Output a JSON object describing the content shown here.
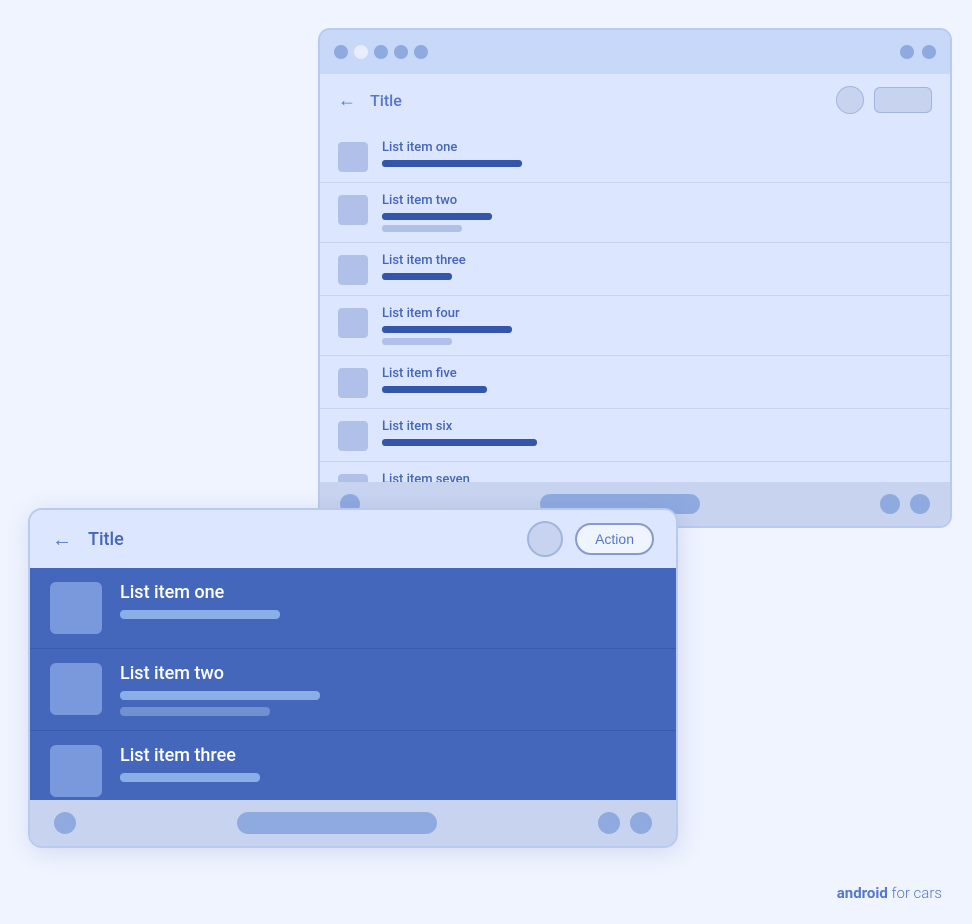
{
  "back_window": {
    "title": "Title",
    "action_btn": "",
    "list_items": [
      {
        "label": "List item one",
        "bar1_w": 140,
        "bar2_w": 0,
        "bar3_w": 0
      },
      {
        "label": "List item two",
        "bar1_w": 110,
        "bar2_w": 80,
        "bar3_w": 0
      },
      {
        "label": "List item three",
        "bar1_w": 70,
        "bar2_w": 0,
        "bar3_w": 0
      },
      {
        "label": "List item four",
        "bar1_w": 130,
        "bar2_w": 70,
        "bar3_w": 0
      },
      {
        "label": "List item five",
        "bar1_w": 105,
        "bar2_w": 0,
        "bar3_w": 0
      },
      {
        "label": "List item six",
        "bar1_w": 155,
        "bar2_w": 0,
        "bar3_w": 0
      },
      {
        "label": "List item seven",
        "bar1_w": 100,
        "bar2_w": 0,
        "bar3_w": 0
      }
    ]
  },
  "front_window": {
    "title": "Title",
    "action_label": "Action",
    "list_items": [
      {
        "label": "List item one",
        "bar1_w": 160,
        "bar2_w": 0,
        "bar3_w": 0
      },
      {
        "label": "List item two",
        "bar1_w": 200,
        "bar2_w": 150,
        "bar3_w": 0
      },
      {
        "label": "List item three",
        "bar1_w": 140,
        "bar2_w": 0,
        "bar3_w": 0
      }
    ]
  },
  "brand": {
    "prefix": "android",
    "suffix": " for cars"
  }
}
